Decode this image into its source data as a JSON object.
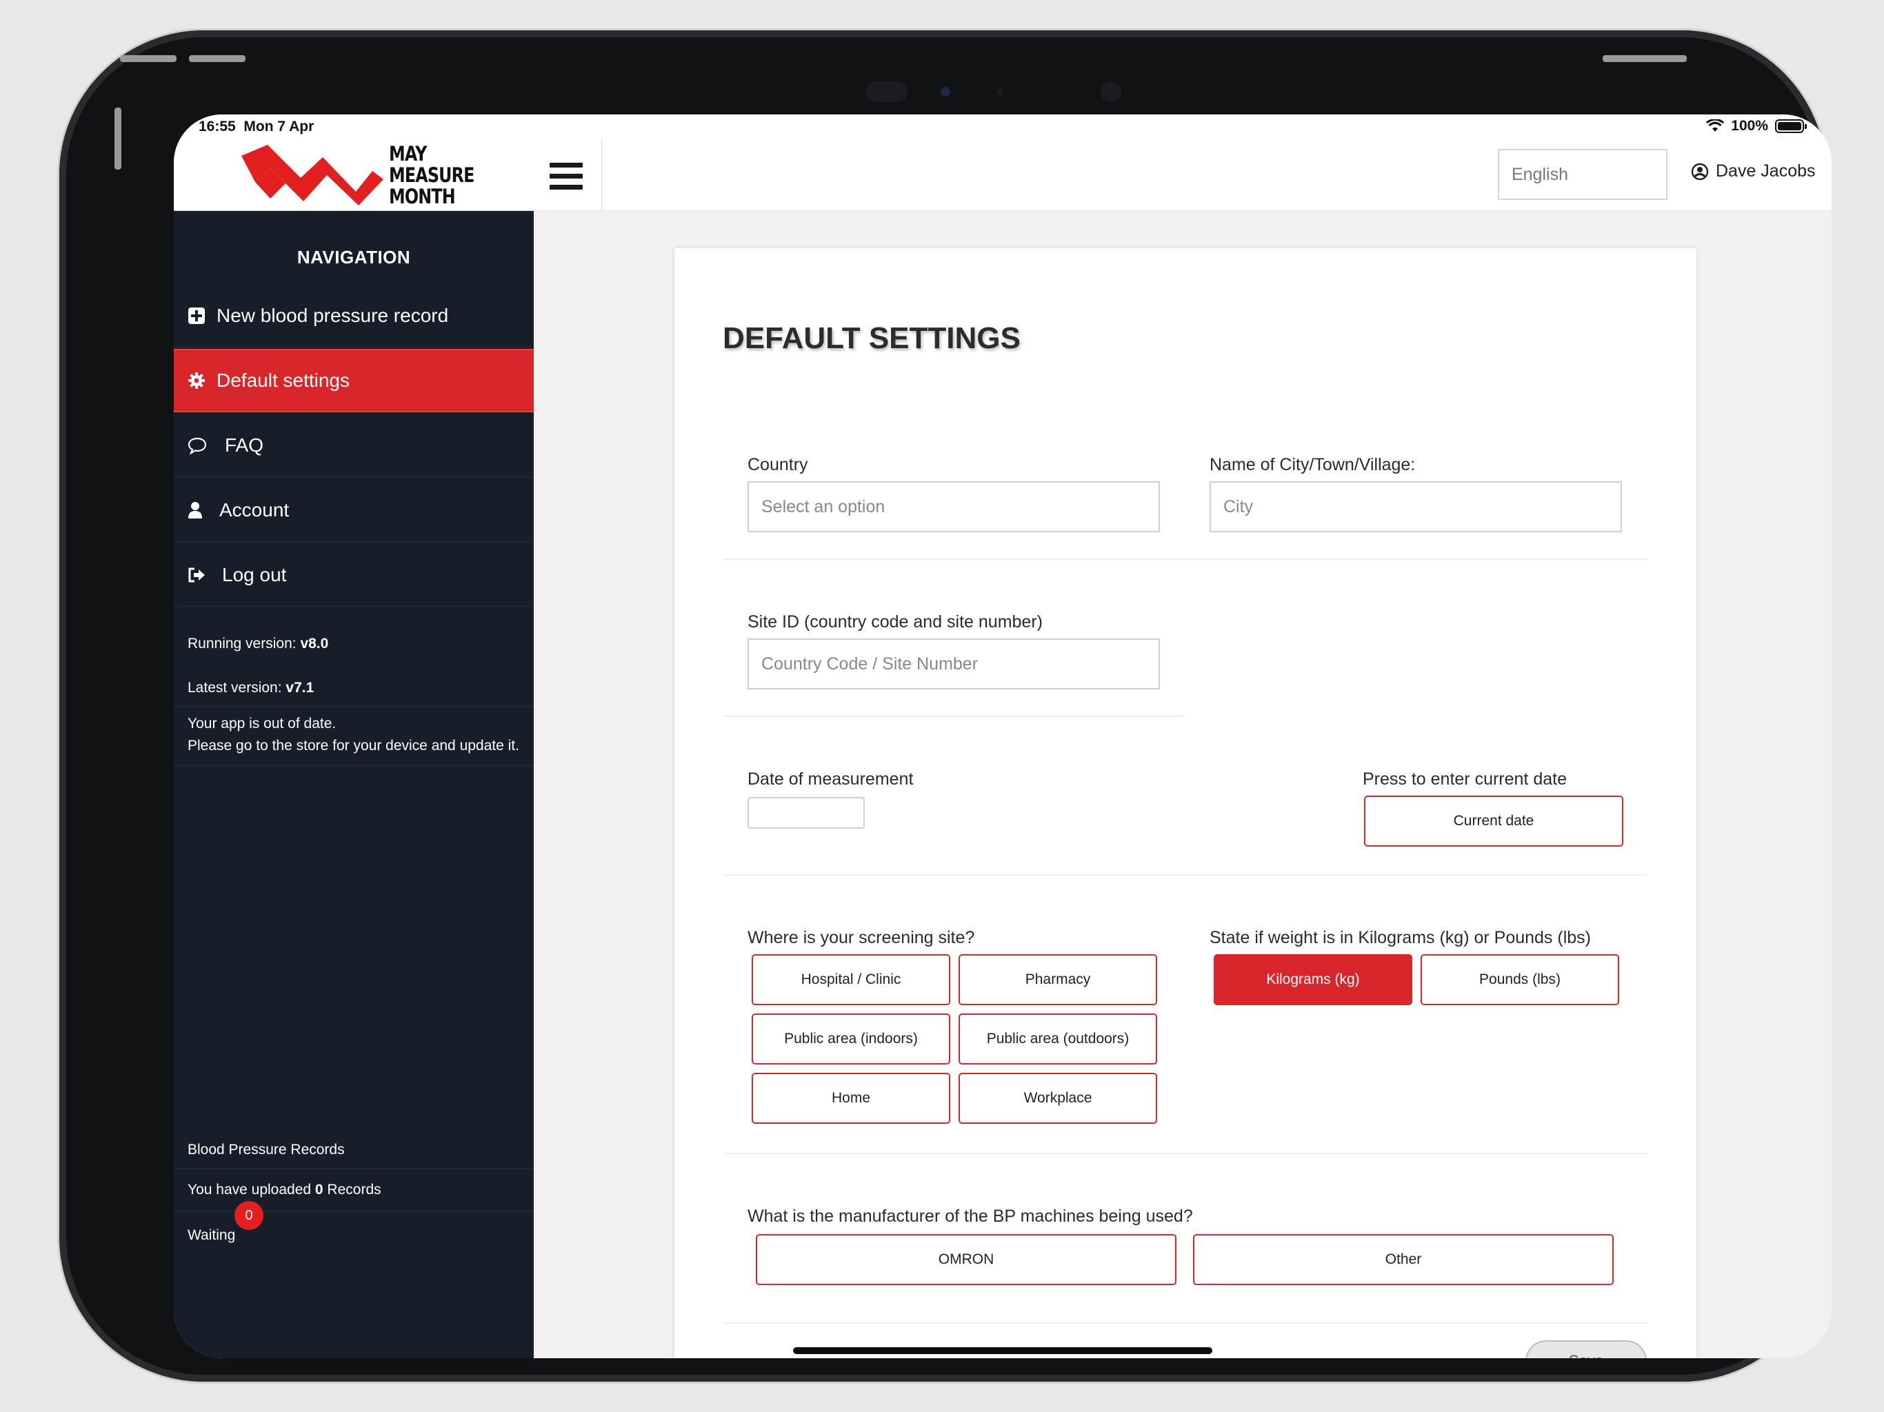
{
  "status": {
    "time": "16:55",
    "date": "Mon 7 Apr",
    "battery": "100%"
  },
  "header": {
    "logo_line1": "MAY",
    "logo_line2": "MEASURE",
    "logo_line3": "MONTH",
    "language": "English",
    "user": "Dave Jacobs"
  },
  "sidebar": {
    "title": "NAVIGATION",
    "items": [
      {
        "label": "New blood pressure record",
        "icon": "plus-square-icon"
      },
      {
        "label": "Default settings",
        "icon": "gear-icon"
      },
      {
        "label": "FAQ",
        "icon": "speech-bubble-icon"
      },
      {
        "label": "Account",
        "icon": "user-icon"
      },
      {
        "label": "Log out",
        "icon": "logout-icon"
      }
    ],
    "running_label": "Running version: ",
    "running_version": "v8.0",
    "latest_label": "Latest version: ",
    "latest_version": "v7.1",
    "outdated_line1": "Your app is out of date.",
    "outdated_line2": "Please go to the store for your device and update it.",
    "records_title": "Blood Pressure Records",
    "uploaded_prefix": "You have uploaded ",
    "uploaded_count": "0",
    "uploaded_suffix": " Records",
    "waiting_label": "Waiting",
    "waiting_count": "0"
  },
  "main": {
    "title": "DEFAULT SETTINGS",
    "country_label": "Country",
    "country_placeholder": "Select an option",
    "city_label": "Name of City/Town/Village:",
    "city_placeholder": "City",
    "site_label": "Site ID (country code and site number)",
    "site_placeholder": "Country Code / Site Number",
    "date_label": "Date of measurement",
    "date_value": "",
    "current_date_label": "Press to enter current date",
    "current_date_button": "Current date",
    "screening_label": "Where is your screening site?",
    "screening_options": [
      "Hospital / Clinic",
      "Pharmacy",
      "Public area (indoors)",
      "Public area (outdoors)",
      "Home",
      "Workplace"
    ],
    "weight_label": "State if weight is in Kilograms (kg) or Pounds (lbs)",
    "weight_options": [
      "Kilograms (kg)",
      "Pounds (lbs)"
    ],
    "weight_selected": "Kilograms (kg)",
    "manufacturer_label": "What is the manufacturer of the BP machines being used?",
    "manufacturer_options": [
      "OMRON",
      "Other"
    ],
    "save_button": "Save"
  },
  "colors": {
    "brand_red": "#d9262a",
    "sidebar_bg": "#171e29"
  }
}
